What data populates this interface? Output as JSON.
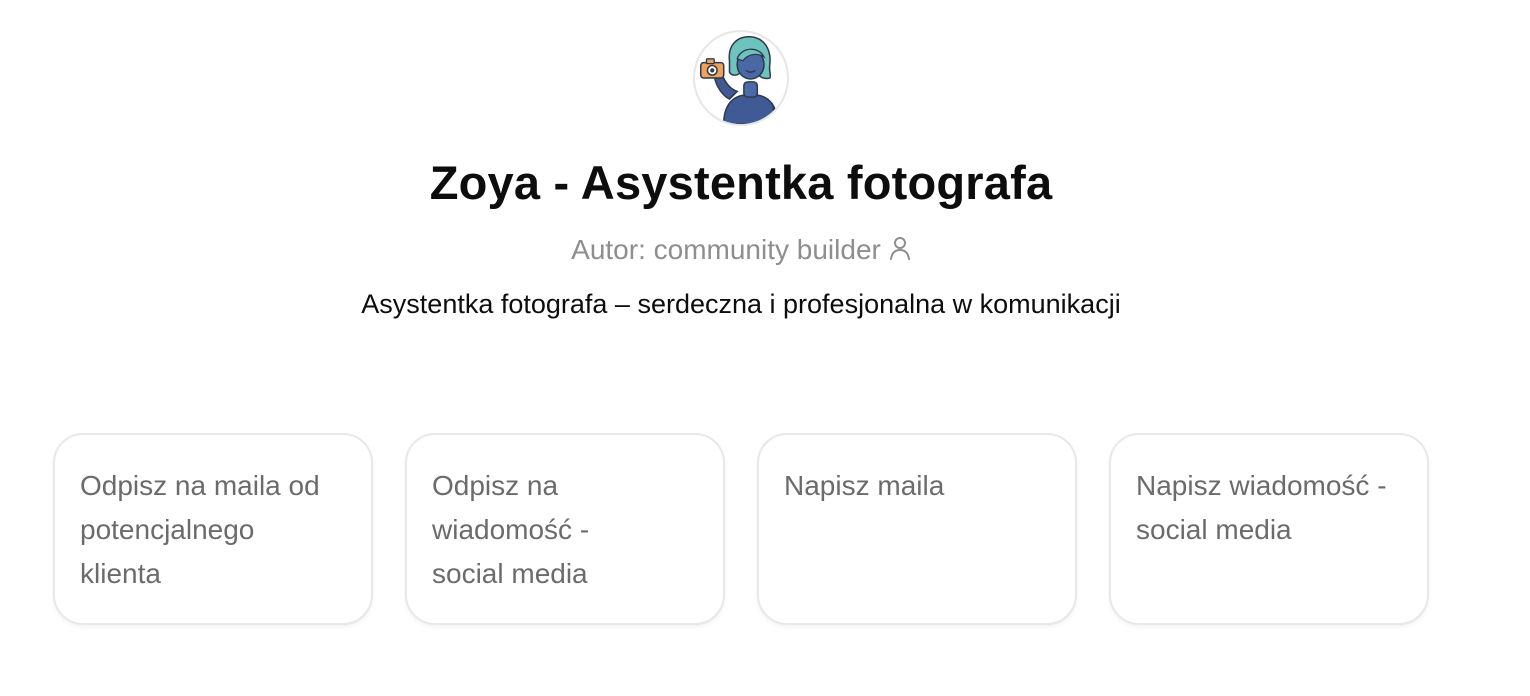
{
  "gpt": {
    "avatar_icon": "photographer-assistant-avatar",
    "title": "Zoya - Asystentka fotografa",
    "author_label": "Autor: community builder",
    "author_icon": "person-icon",
    "description": "Asystentka fotografa – serdeczna i profesjonalna w komunikacji"
  },
  "prompts": [
    {
      "label": "Odpisz na maila od potencjalnego klienta"
    },
    {
      "label": "Odpisz na wiadomość - social media"
    },
    {
      "label": "Napisz maila"
    },
    {
      "label": "Napisz wiadomość - social media"
    }
  ],
  "colors": {
    "text_primary": "#0d0d0d",
    "text_muted": "#8e8e8e",
    "card_text": "#6b6b6b",
    "card_border": "#e8e8e8"
  }
}
